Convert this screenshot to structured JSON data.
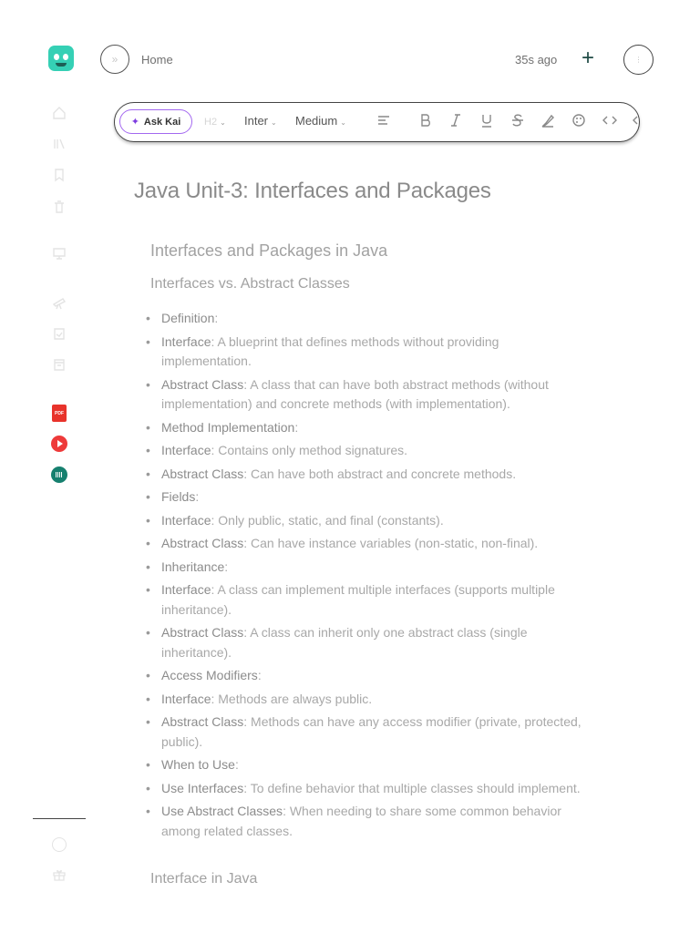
{
  "header": {
    "home_label": "Home",
    "last_saved": "35s ago"
  },
  "toolbar": {
    "ask_kai": "Ask Kai",
    "heading_level": "H2",
    "font": "Inter",
    "weight": "Medium"
  },
  "document": {
    "title": "Java Unit-3: Interfaces and Packages",
    "section_heading": "Interfaces and Packages in Java",
    "sub_heading": "Interfaces vs. Abstract Classes",
    "bullets": [
      {
        "term": "Definition",
        "text": ":"
      },
      {
        "term": "Interface",
        "text": ": A blueprint that defines methods without providing implementation."
      },
      {
        "term": "Abstract Class",
        "text": ": A class that can have both abstract methods (without implementation) and concrete methods (with implementation)."
      },
      {
        "term": "Method Implementation",
        "text": ":"
      },
      {
        "term": "Interface",
        "text": ": Contains only method signatures."
      },
      {
        "term": "Abstract Class",
        "text": ": Can have both abstract and concrete methods."
      },
      {
        "term": "Fields",
        "text": ":"
      },
      {
        "term": "Interface",
        "text": ": Only public, static, and final (constants)."
      },
      {
        "term": "Abstract Class",
        "text": ": Can have instance variables (non-static, non-final)."
      },
      {
        "term": "Inheritance",
        "text": ":"
      },
      {
        "term": "Interface",
        "text": ": A class can implement multiple interfaces (supports multiple inheritance)."
      },
      {
        "term": "Abstract Class",
        "text": ": A class can inherit only one abstract class (single inheritance)."
      },
      {
        "term": "Access Modifiers",
        "text": ":"
      },
      {
        "term": "Interface",
        "text": ": Methods are always public."
      },
      {
        "term": "Abstract Class",
        "text": ": Methods can have any access modifier (private, protected, public)."
      },
      {
        "term": "When to Use",
        "text": ":"
      },
      {
        "term": "Use Interfaces",
        "text": ": To define behavior that multiple classes should implement."
      },
      {
        "term": "Use Abstract Classes",
        "text": ": When needing to share some common behavior among related classes."
      }
    ],
    "next_heading": "Interface in Java"
  },
  "sidebar": {
    "pdf_icon_label": "PDF"
  },
  "colors": {
    "logo": "#35d0b5",
    "ask_kai_border": "#a368f0",
    "pdf": "#e8332b",
    "play": "#ee3a3a",
    "audio": "#16806f",
    "plus": "#1f4a45"
  }
}
